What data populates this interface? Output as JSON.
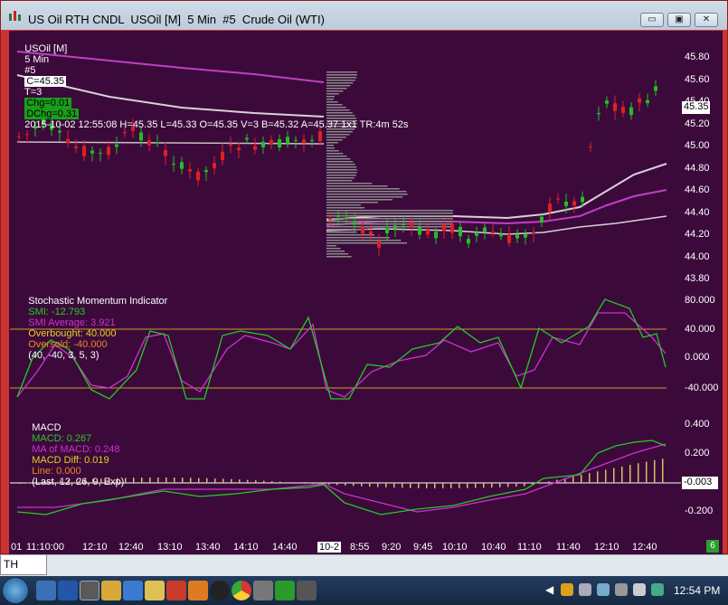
{
  "window": {
    "title": "US Oil RTH CNDL  USOil [M]  5 Min  #5  Crude Oil (WTI)",
    "minimize": "▭",
    "maximize": "▣",
    "close": "✕"
  },
  "header": {
    "symbol": "USOil [M]",
    "interval": "5 Min",
    "chart_no": "#5",
    "close": "C=45.35",
    "ticks": "T=3",
    "chg": "Chg=0.01",
    "dchg": "DChg=0.31",
    "stats": "2015-10-02 12:55:08 H=45.35 L=45.33 O=45.35 V=3 B=45.32 A=45.37 1x1 TR:4m 52s"
  },
  "price_axis": [
    "45.80",
    "45.60",
    "45.40",
    "45.20",
    "45.00",
    "44.80",
    "44.60",
    "44.40",
    "44.20",
    "44.00",
    "43.80"
  ],
  "current_price": "45.35",
  "stoch": {
    "name": "Stochastic Momentum Indicator",
    "smi": "SMI: -12.793",
    "smi_avg": "SMI Average: 3.921",
    "overbought": "Overbought: 40.000",
    "oversold": "Oversold: -40.000",
    "params": "(40, -40, 3, 5, 3)",
    "axis": [
      "80.000",
      "40.000",
      "0.000",
      "-40.000"
    ]
  },
  "macd": {
    "name": "MACD",
    "macd": "MACD: 0.267",
    "ma": "MA of MACD: 0.248",
    "diff": "MACD Diff: 0.019",
    "line": "Line: 0.000",
    "params": "(Last, 12, 26, 9, Exp)",
    "axis": [
      "0.400",
      "0.200",
      "-0.003",
      "-0.200"
    ],
    "current": "-0.003"
  },
  "time_axis": [
    "01",
    "11:10:00",
    "12:10",
    "12:40",
    "13:10",
    "13:40",
    "14:10",
    "14:40",
    "10-2",
    "8:55",
    "9:20",
    "9:45",
    "10:10",
    "10:40",
    "11:10",
    "11:40",
    "12:10",
    "12:40"
  ],
  "corner_badge": "6",
  "tab": {
    "label": "TH CNDL"
  },
  "taskbar": {
    "time": "12:54 PM"
  },
  "colors": {
    "background": "#3b0a3b",
    "up": "#22c022",
    "down": "#e02020",
    "smi": "#22cc22",
    "smi_avg": "#cc33cc",
    "levels": "#d49a2a"
  },
  "icons": [
    "start-orb-icon",
    "browser-icon",
    "word-icon",
    "explorer-icon",
    "chart-app-icon",
    "notes-icon",
    "firefox-icon",
    "clock-icon",
    "chrome-icon",
    "folder-icon"
  ]
}
